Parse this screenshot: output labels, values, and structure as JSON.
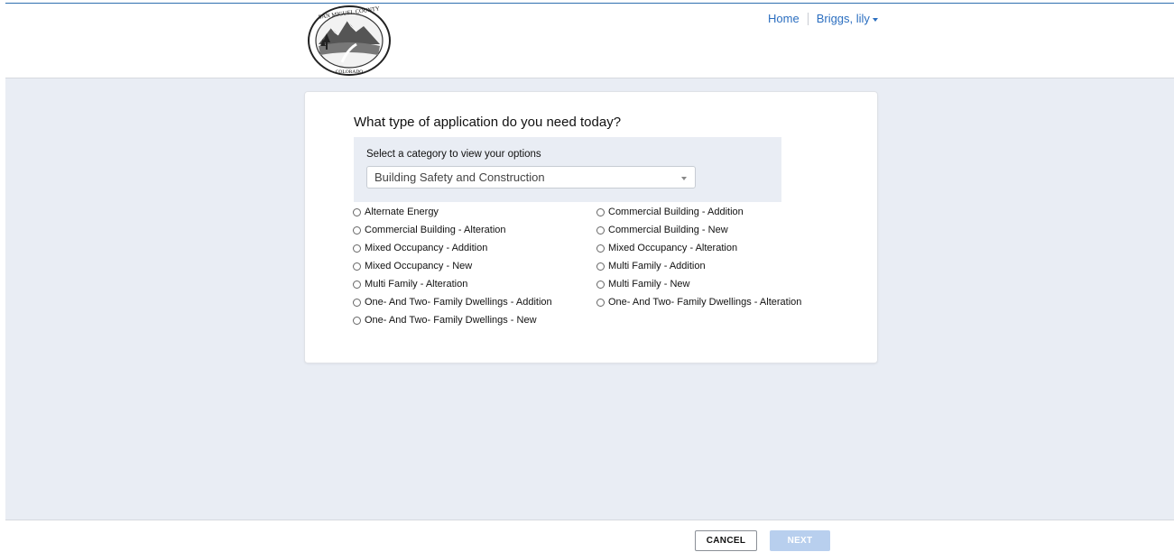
{
  "header": {
    "logo_alt": "San Miguel County Colorado seal",
    "nav": {
      "home": "Home",
      "user": "Briggs, lily"
    }
  },
  "card": {
    "question": "What type of application do you need today?",
    "category_label": "Select a category to view your options",
    "category_selected": "Building Safety and Construction"
  },
  "options": {
    "left": [
      "Alternate Energy",
      "Commercial Building - Alteration",
      "Mixed Occupancy - Addition",
      "Mixed Occupancy - New",
      "Multi Family - Alteration",
      "One- And Two- Family Dwellings - Addition",
      "One- And Two- Family Dwellings - New"
    ],
    "right": [
      "Commercial Building - Addition",
      "Commercial Building - New",
      "Mixed Occupancy - Alteration",
      "Multi Family - Addition",
      "Multi Family - New",
      "One- And Two- Family Dwellings - Alteration"
    ]
  },
  "footer": {
    "cancel_label": "CANCEL",
    "next_label": "NEXT"
  },
  "colors": {
    "link": "#2c6fc0",
    "background": "#e9edf4",
    "next_disabled": "#b8cfee"
  }
}
